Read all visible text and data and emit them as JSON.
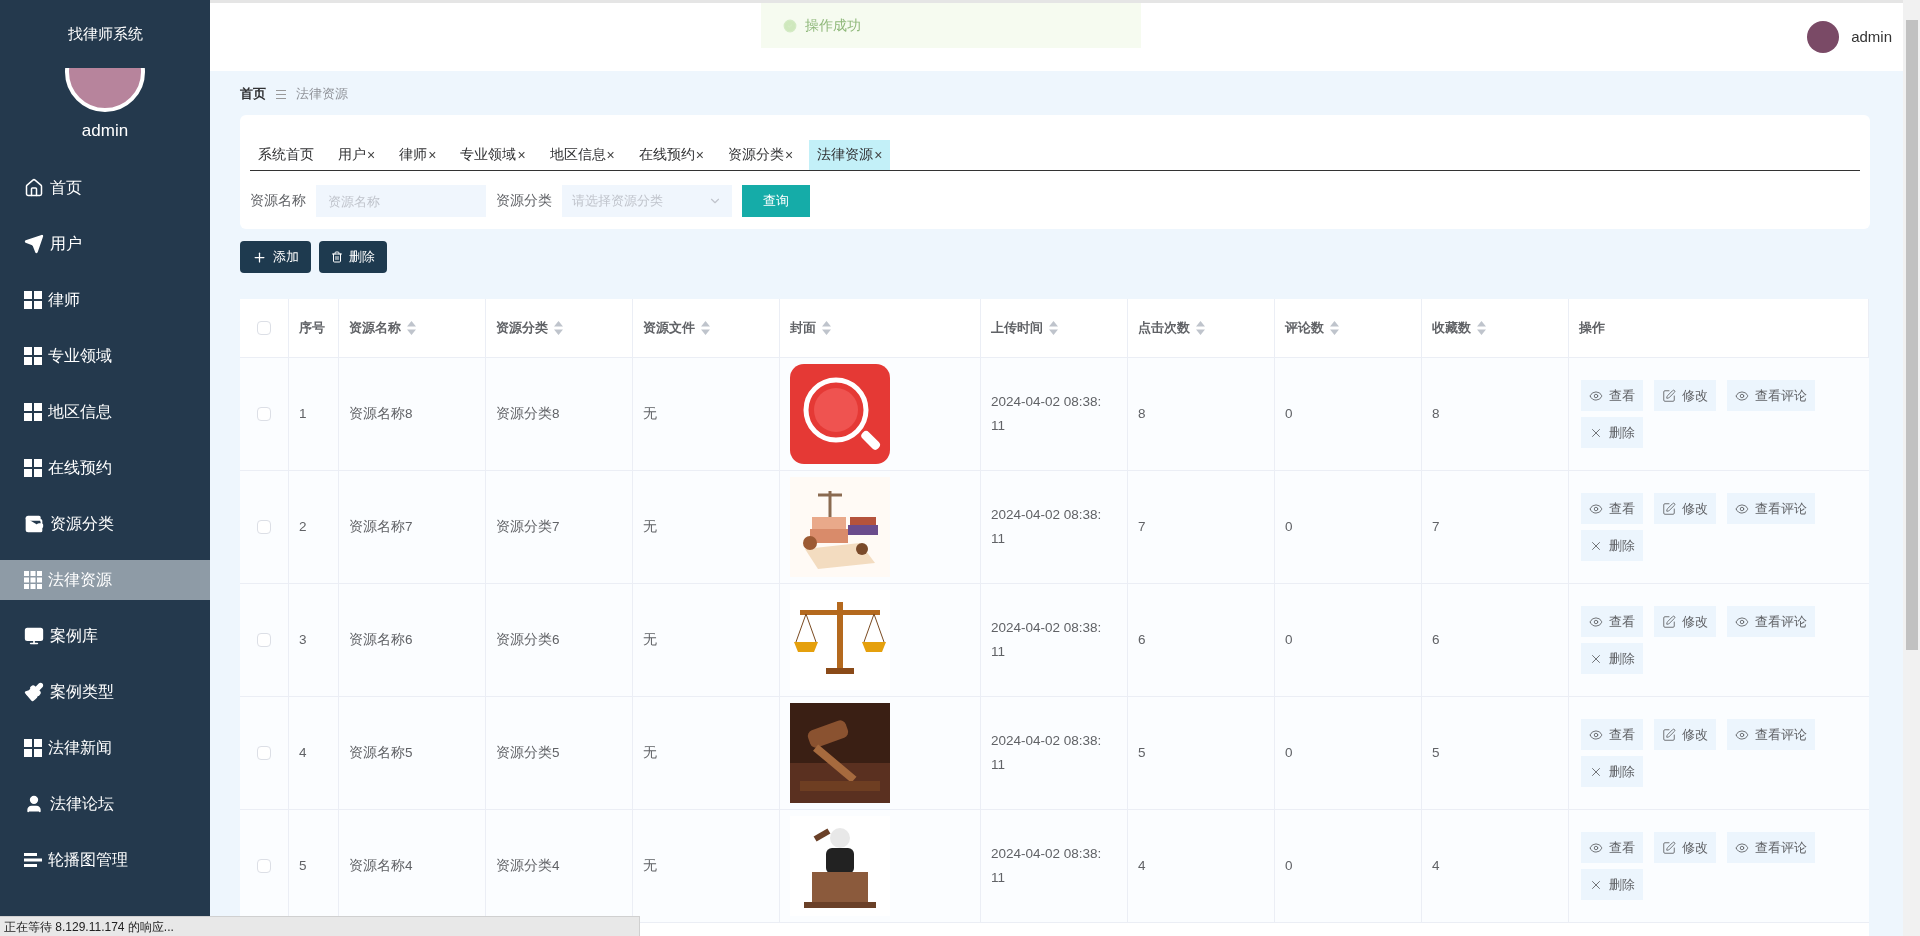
{
  "sidebar": {
    "title": "找律师系统",
    "user": "admin",
    "items": [
      {
        "label": "首页",
        "kind": "home",
        "selected": false
      },
      {
        "label": "用户",
        "kind": "send",
        "selected": false
      },
      {
        "label": "律师",
        "kind": "grid",
        "selected": false
      },
      {
        "label": "专业领域",
        "kind": "grid",
        "selected": false
      },
      {
        "label": "地区信息",
        "kind": "grid",
        "selected": false
      },
      {
        "label": "在线预约",
        "kind": "grid",
        "selected": false
      },
      {
        "label": "资源分类",
        "kind": "wallet",
        "selected": false
      },
      {
        "label": "法律资源",
        "kind": "grid9",
        "selected": true
      },
      {
        "label": "案例库",
        "kind": "monitor",
        "selected": false
      },
      {
        "label": "案例类型",
        "kind": "brush",
        "selected": false
      },
      {
        "label": "法律新闻",
        "kind": "grid",
        "selected": false
      },
      {
        "label": "法律论坛",
        "kind": "user",
        "selected": false
      },
      {
        "label": "轮播图管理",
        "kind": "list",
        "selected": false
      }
    ]
  },
  "header": {
    "toast": "操作成功",
    "user": "admin"
  },
  "breadcrumb": [
    "首页",
    "法律资源"
  ],
  "tabs": [
    {
      "label": "系统首页",
      "closable": false,
      "selected": false
    },
    {
      "label": "用户",
      "closable": true,
      "selected": false
    },
    {
      "label": "律师",
      "closable": true,
      "selected": false
    },
    {
      "label": "专业领域",
      "closable": true,
      "selected": false
    },
    {
      "label": "地区信息",
      "closable": true,
      "selected": false
    },
    {
      "label": "在线预约",
      "closable": true,
      "selected": false
    },
    {
      "label": "资源分类",
      "closable": true,
      "selected": false
    },
    {
      "label": "法律资源",
      "closable": true,
      "selected": true
    }
  ],
  "close_mark": "×",
  "search": {
    "fields": [
      {
        "label": "资源名称",
        "kind": "text",
        "placeholder": "资源名称"
      },
      {
        "label": "资源分类",
        "kind": "select",
        "placeholder": "请选择资源分类"
      }
    ],
    "button": "查询"
  },
  "actions": [
    {
      "label": "添加",
      "kind": "add"
    },
    {
      "label": "删除",
      "kind": "delete"
    }
  ],
  "table": {
    "all_checked": false,
    "columns": [
      {
        "label": "序号",
        "sortable": false
      },
      {
        "label": "资源名称",
        "sortable": true
      },
      {
        "label": "资源分类",
        "sortable": true
      },
      {
        "label": "资源文件",
        "sortable": true
      },
      {
        "label": "封面",
        "sortable": true
      },
      {
        "label": "上传时间",
        "sortable": true
      },
      {
        "label": "点击次数",
        "sortable": true
      },
      {
        "label": "评论数",
        "sortable": true
      },
      {
        "label": "收藏数",
        "sortable": true
      },
      {
        "label": "操作",
        "sortable": false
      }
    ],
    "rows": [
      {
        "checked": false,
        "cells": [
          "1",
          "资源名称8",
          "资源分类8",
          "无"
        ],
        "cover": {
          "kind": "picture"
        },
        "time": "2024-04-02 08:38:11",
        "counts": [
          "8",
          "0",
          "8"
        ],
        "buttons": [
          {
            "label": "查看",
            "kind": "view"
          },
          {
            "label": "修改",
            "kind": "edit"
          },
          {
            "label": "查看评论",
            "kind": "view"
          },
          {
            "label": "删除",
            "kind": "delete"
          }
        ]
      },
      {
        "checked": false,
        "cells": [
          "2",
          "资源名称7",
          "资源分类7",
          "无"
        ],
        "cover": {
          "kind": "picture"
        },
        "time": "2024-04-02 08:38:11",
        "counts": [
          "7",
          "0",
          "7"
        ],
        "buttons": [
          {
            "label": "查看",
            "kind": "view"
          },
          {
            "label": "修改",
            "kind": "edit"
          },
          {
            "label": "查看评论",
            "kind": "view"
          },
          {
            "label": "删除",
            "kind": "delete"
          }
        ]
      },
      {
        "checked": false,
        "cells": [
          "3",
          "资源名称6",
          "资源分类6",
          "无"
        ],
        "cover": {
          "kind": "picture"
        },
        "time": "2024-04-02 08:38:11",
        "counts": [
          "6",
          "0",
          "6"
        ],
        "buttons": [
          {
            "label": "查看",
            "kind": "view"
          },
          {
            "label": "修改",
            "kind": "edit"
          },
          {
            "label": "查看评论",
            "kind": "view"
          },
          {
            "label": "删除",
            "kind": "delete"
          }
        ]
      },
      {
        "checked": false,
        "cells": [
          "4",
          "资源名称5",
          "资源分类5",
          "无"
        ],
        "cover": {
          "kind": "picture"
        },
        "time": "2024-04-02 08:38:11",
        "counts": [
          "5",
          "0",
          "5"
        ],
        "buttons": [
          {
            "label": "查看",
            "kind": "view"
          },
          {
            "label": "修改",
            "kind": "edit"
          },
          {
            "label": "查看评论",
            "kind": "view"
          },
          {
            "label": "删除",
            "kind": "delete"
          }
        ]
      },
      {
        "checked": false,
        "cells": [
          "5",
          "资源名称4",
          "资源分类4",
          "无"
        ],
        "cover": {
          "kind": "picture"
        },
        "time": "2024-04-02 08:38:11",
        "counts": [
          "4",
          "0",
          "4"
        ],
        "buttons": [
          {
            "label": "查看",
            "kind": "view"
          },
          {
            "label": "修改",
            "kind": "edit"
          },
          {
            "label": "查看评论",
            "kind": "view"
          },
          {
            "label": "删除",
            "kind": "delete"
          }
        ]
      }
    ]
  },
  "status_bar": "正在等待 8.129.11.174 的响应..."
}
